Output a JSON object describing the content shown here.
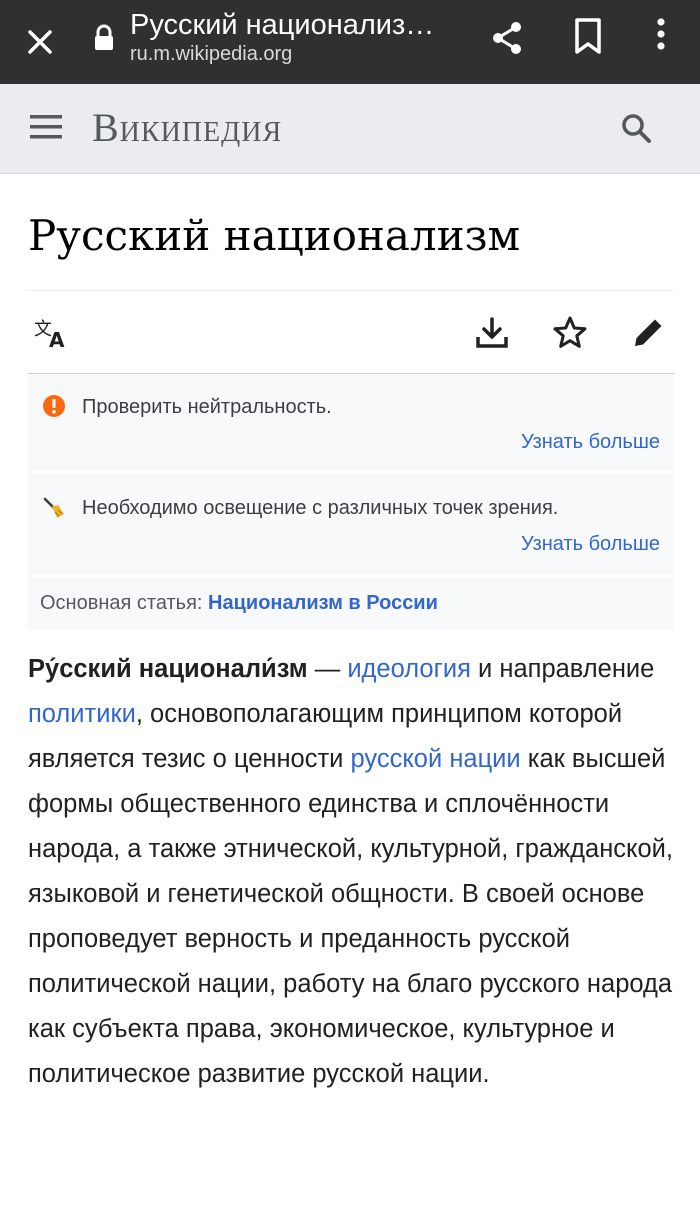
{
  "browser": {
    "tab_title": "Русский национализ…",
    "url": "ru.m.wikipedia.org",
    "icons": [
      "close-icon",
      "lock-icon",
      "share-icon",
      "bookmark-icon",
      "more-vert-icon"
    ]
  },
  "wiki_header": {
    "logo_text": "Википедия",
    "icons": [
      "menu-icon",
      "search-icon"
    ]
  },
  "article": {
    "title": "Русский национализм",
    "toolbar_icons": [
      "language-icon",
      "download-icon",
      "star-icon",
      "edit-icon"
    ]
  },
  "notices": [
    {
      "icon": "exclamation-icon",
      "text": "Проверить нейтральность.",
      "link": "Узнать больше"
    },
    {
      "icon": "broom-icon",
      "text": "Необходимо освещение с различных точек зрения.",
      "link": "Узнать больше"
    }
  ],
  "hatnote": {
    "prefix": "Основная статья: ",
    "link": "Национализм в России"
  },
  "body": {
    "term": "Ру́сский национали́зм",
    "seg1": " — ",
    "link1": "идеология",
    "seg2": " и направление ",
    "link2": "политики",
    "seg3": ", основополагающим принципом которой является тезис о ценности ",
    "link3": "русской нации",
    "seg4": " как высшей формы общественного единства и сплочённости народа, а также этнической, культурной, гражданской, языковой и генетической общности. В своей основе проповедует верность и преданность русской политической нации, работу на благо русского народа как субъекта права, экономическое, культурное и политическое развитие русской нации."
  },
  "colors": {
    "browser_bar": "#2f3031",
    "header_bg": "#eaecf0",
    "link": "#3366cc",
    "warning": "#fc6a10",
    "text": "#202122"
  }
}
